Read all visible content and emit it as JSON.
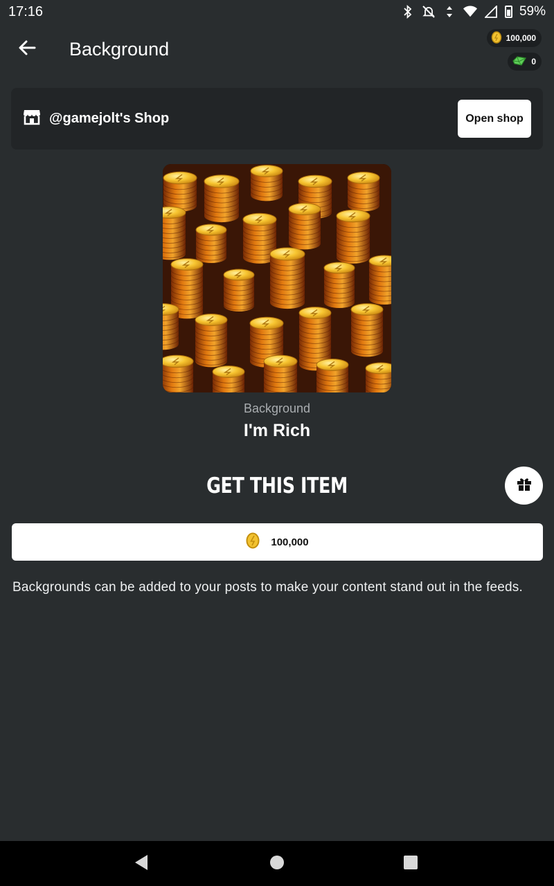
{
  "status_bar": {
    "time": "17:16",
    "battery": "59%",
    "icons": [
      "bluetooth-icon",
      "notifications-off-icon",
      "data-arrows-icon",
      "wifi-icon",
      "signal-icon",
      "battery-icon"
    ]
  },
  "header": {
    "title": "Background",
    "back_icon": "arrow-left-icon",
    "coins": "100,000",
    "gems": "0"
  },
  "shop": {
    "name": "@gamejolt's Shop",
    "icon": "storefront-icon",
    "open_label": "Open shop"
  },
  "item": {
    "type": "Background",
    "name": "I'm Rich",
    "image": "stacks-of-gold-coins"
  },
  "purchase": {
    "title": "GET THIS ITEM",
    "gift_icon": "gift-icon",
    "price": "100,000",
    "price_icon": "coin-icon"
  },
  "description": "Backgrounds can be added to your posts to make your content stand out in the feeds.",
  "nav": {
    "back": "nav-back-icon",
    "home": "nav-home-icon",
    "recents": "nav-recents-icon"
  },
  "colors": {
    "background": "#292d2f",
    "card": "#222527",
    "coin_gold": "#e8b92a"
  }
}
